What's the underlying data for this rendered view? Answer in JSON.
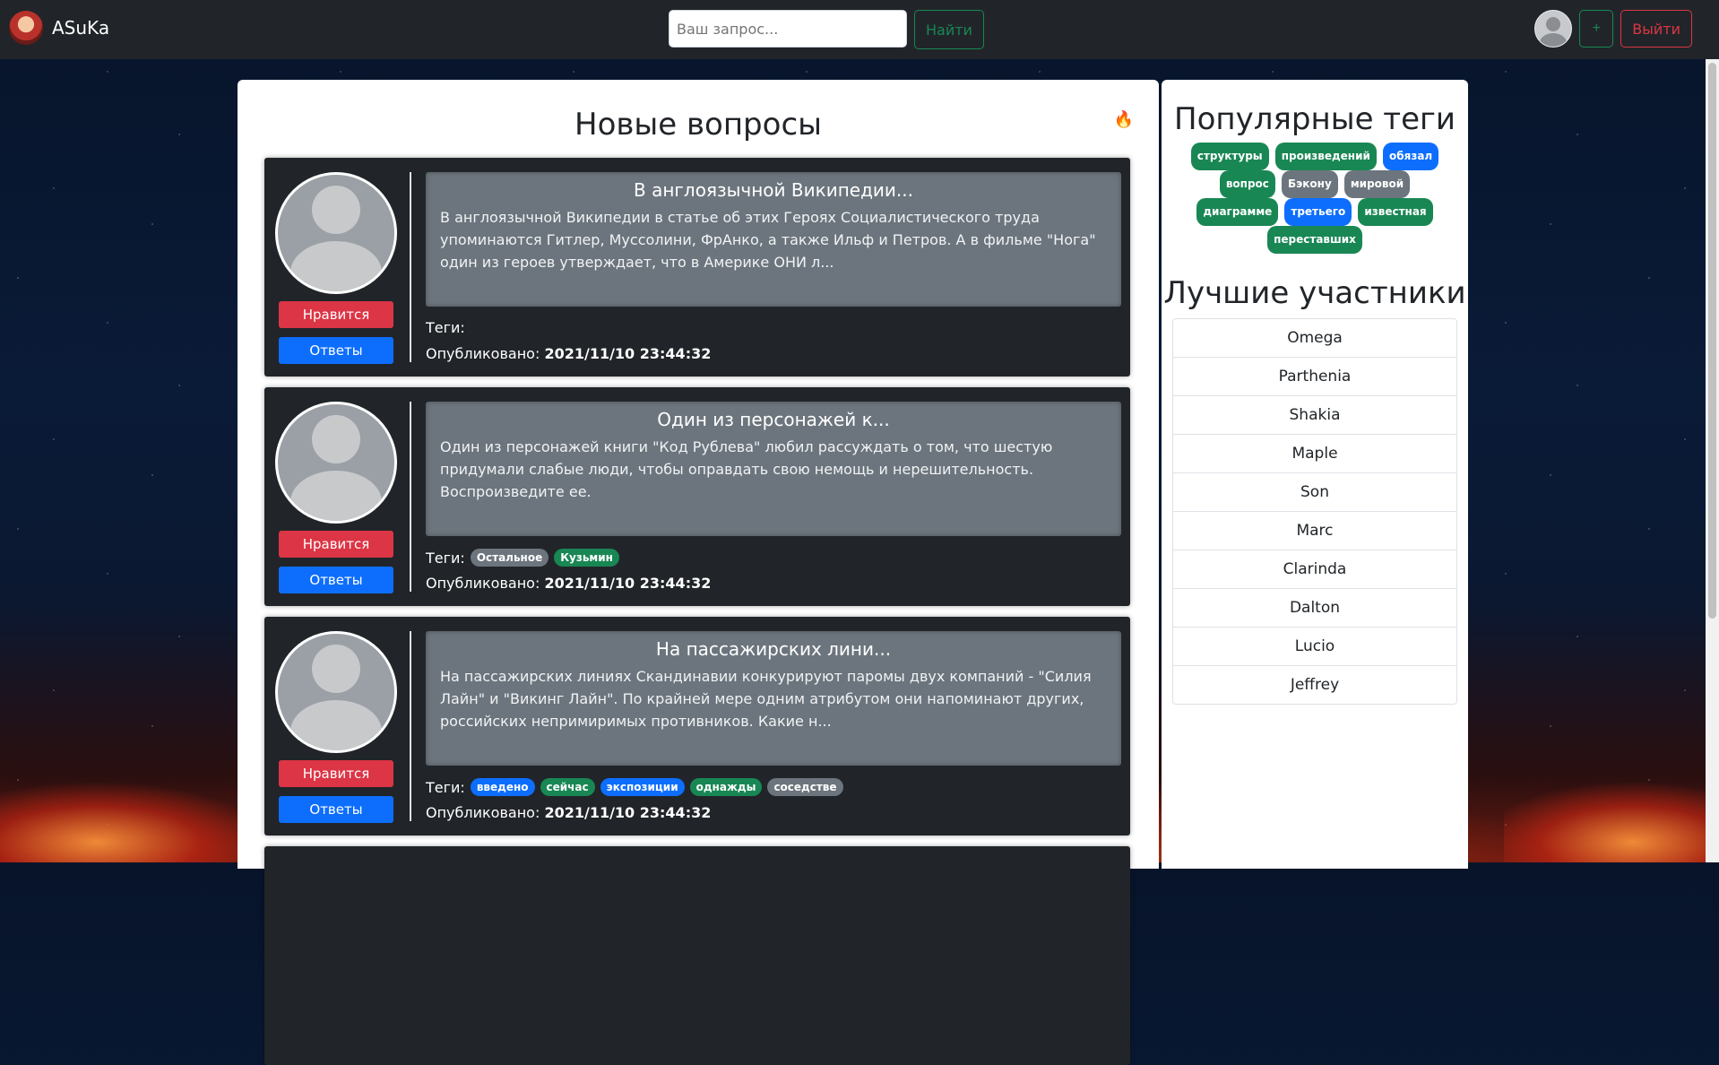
{
  "navbar": {
    "brand": "ASuKa",
    "search_placeholder": "Ваш запрос...",
    "search_button": "Найти",
    "add_button": "+",
    "logout_button": "Выйти"
  },
  "main": {
    "title": "Новые вопросы",
    "questions": [
      {
        "title": "В англоязычной Википедии...",
        "text": "В англоязычной Википедии в статье об этих Героях Социалистического труда упоминаются Гитлер, Муссолини, ФрАнко, а также Ильф и Петров. А в фильме \"Нога\" один из героев утверждает, что в Америке ОНИ л...",
        "like": "Нравится",
        "answers": "Ответы",
        "tags_label": "Теги:",
        "tags": [],
        "published_label": "Опубликовано:",
        "date": "2021/11/10 23:44:32"
      },
      {
        "title": "Один из персонажей к...",
        "text": "Один из персонажей книги \"Код Рублева\" любил рассуждать о том, что шестую придумали слабые люди, чтобы оправдать свою немощь и нерешительность. Воспроизведите ее.",
        "like": "Нравится",
        "answers": "Ответы",
        "tags_label": "Теги:",
        "tags": [
          {
            "label": "Остальное",
            "color": "gray"
          },
          {
            "label": "Кузьмин",
            "color": "green"
          }
        ],
        "published_label": "Опубликовано:",
        "date": "2021/11/10 23:44:32"
      },
      {
        "title": "На пассажирских лини...",
        "text": "На пассажирских линиях Скандинавии конкурируют паромы двух компаний - \"Силия Лайн\" и \"Викинг Лайн\". По крайней мере одним атрибутом они напоминают других, российских непримиримых противников. Какие н...",
        "like": "Нравится",
        "answers": "Ответы",
        "tags_label": "Теги:",
        "tags": [
          {
            "label": "введено",
            "color": "blue"
          },
          {
            "label": "сейчас",
            "color": "green"
          },
          {
            "label": "экспозиции",
            "color": "blue"
          },
          {
            "label": "однажды",
            "color": "green"
          },
          {
            "label": "соседстве",
            "color": "gray"
          }
        ],
        "published_label": "Опубликовано:",
        "date": "2021/11/10 23:44:32"
      }
    ]
  },
  "sidebar": {
    "popular_title": "Популярные теги",
    "popular_tags": [
      {
        "label": "структуры",
        "color": "green"
      },
      {
        "label": "произведений",
        "color": "green"
      },
      {
        "label": "обязал",
        "color": "blue"
      },
      {
        "label": "вопрос",
        "color": "green"
      },
      {
        "label": "Бэкону",
        "color": "gray"
      },
      {
        "label": "мировой",
        "color": "gray"
      },
      {
        "label": "диаграмме",
        "color": "green"
      },
      {
        "label": "третьего",
        "color": "blue"
      },
      {
        "label": "известная",
        "color": "green"
      },
      {
        "label": "переставших",
        "color": "green"
      }
    ],
    "best_title": "Лучшие участники",
    "best_members": [
      "Omega",
      "Parthenia",
      "Shakia",
      "Maple",
      "Son",
      "Marc",
      "Clarinda",
      "Dalton",
      "Lucio",
      "Jeffrey"
    ]
  },
  "colors": {
    "navbar_bg": "#212529",
    "like_red": "#dc3545",
    "answers_blue": "#0d6efd",
    "tag_green": "#198754",
    "tag_gray": "#6c757d",
    "tag_blue": "#0d6efd"
  },
  "icons": {
    "fire": "fire-icon"
  }
}
